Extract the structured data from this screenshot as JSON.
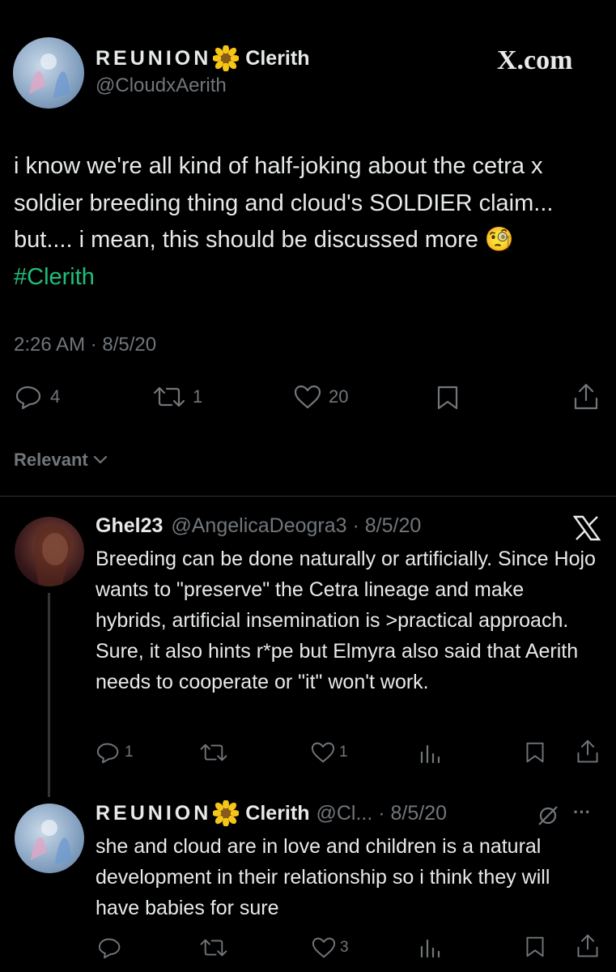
{
  "main_tweet": {
    "display_name_prefix": "REUNION",
    "display_name_suffix": "Clerith",
    "handle": "@CloudxAerith",
    "brand": "X.com",
    "text": "i know we're all kind of half-joking about the cetra x soldier breeding thing and cloud's SOLDIER claim... but.... i mean, this should be discussed more",
    "emoji": "🧐",
    "hashtag": "#Clerith",
    "timestamp": "2:26 AM · 8/5/20",
    "replies": "4",
    "retweets": "1",
    "likes": "20"
  },
  "sort_label": "Relevant",
  "replies": [
    {
      "display_name": "Ghel23",
      "handle_and_date": "@AngelicaDeogra3 · 8/5/20",
      "text": "Breeding can be done naturally or artificially. Since Hojo wants to \"preserve\" the Cetra lineage and make hybrids, artificial insemination is >practical approach. Sure, it also hints r*pe but Elmyra also said that Aerith needs to cooperate or \"it\" won't work.",
      "replies": "1",
      "retweets": "",
      "likes": "1"
    },
    {
      "display_name_prefix": "REUNION",
      "display_name_suffix": "Clerith",
      "handle_and_date": "@Cl... · 8/5/20",
      "more": "···",
      "text": "she and cloud are in love and children is a natural development in their relationship so i think they will have babies for sure",
      "replies": "",
      "retweets": "",
      "likes": "3"
    }
  ],
  "colors": {
    "hashtag": "#1fbf7a",
    "muted": "#71767b",
    "text": "#e7e9ea",
    "background": "#000000"
  }
}
